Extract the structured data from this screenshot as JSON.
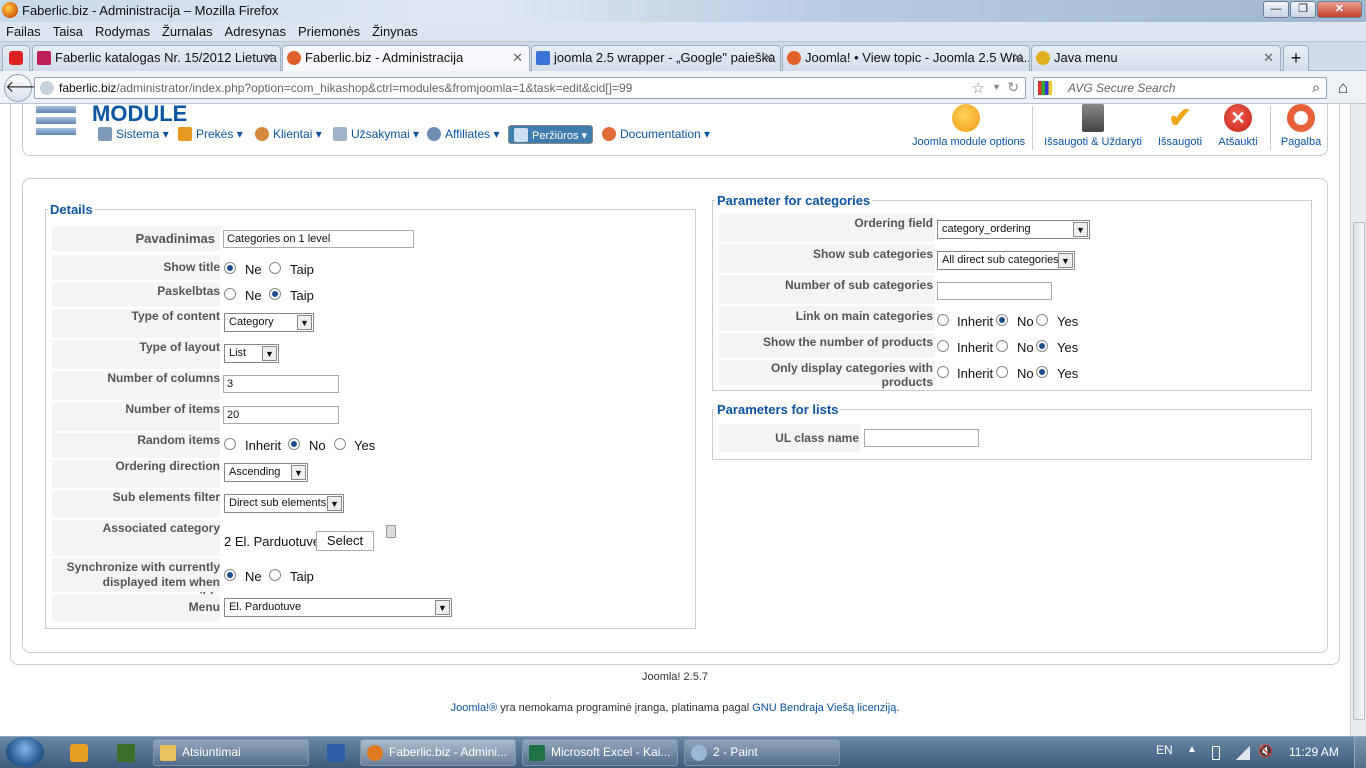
{
  "window": {
    "title": "Faberlic.biz - Administracija – Mozilla Firefox"
  },
  "menubar": [
    "Failas",
    "Taisa",
    "Rodymas",
    "Žurnalas",
    "Adresynas",
    "Priemonės",
    "Žinynas"
  ],
  "tabs": [
    {
      "label": "Faberlic katalogas Nr. 15/2012 Lietuva",
      "icon": "faberlic-icon",
      "color": "#c0205a"
    },
    {
      "label": "Faberlic.biz - Administracija",
      "icon": "joomla-icon",
      "color": "#e0622a"
    },
    {
      "label": "joomla 2.5 wrapper - „Google\" paieška",
      "icon": "google-icon",
      "color": "#3b73d6"
    },
    {
      "label": "Joomla! • View topic - Joomla 2.5 Wra...",
      "icon": "joomla-icon",
      "color": "#e0622a"
    },
    {
      "label": "Java menu",
      "icon": "star-icon",
      "color": "#e0b020"
    }
  ],
  "url": {
    "domain": "faberlic.biz",
    "path": "/administrator/index.php?option=com_hikashop&ctrl=modules&fromjoomla=1&task=edit&cid[]=99"
  },
  "search": {
    "placeholder": "AVG Secure Search"
  },
  "header": {
    "title": "MODULE",
    "nav": [
      "Sistema",
      "Prekės",
      "Klientai",
      "Užsakymai",
      "Affiliates",
      "Peržiūros",
      "Documentation"
    ],
    "toolbar": [
      "Joomla module options",
      "Išsaugoti & Uždaryti",
      "Išsaugoti",
      "Atšaukti",
      "Pagalba"
    ]
  },
  "details": {
    "legend": "Details",
    "name_label": "Pavadinimas",
    "name_value": "Categories on 1 level",
    "show_title_label": "Show title",
    "published_label": "Paskelbtas",
    "ne": "Ne",
    "taip": "Taip",
    "content_type_label": "Type of content",
    "content_type_value": "Category",
    "layout_label": "Type of layout",
    "layout_value": "List",
    "columns_label": "Number of columns",
    "columns_value": "3",
    "items_label": "Number of items",
    "items_value": "20",
    "random_label": "Random items",
    "inherit": "Inherit",
    "no": "No",
    "yes": "Yes",
    "ordering_dir_label": "Ordering direction",
    "ordering_dir_value": "Ascending",
    "sub_filter_label": "Sub elements filter",
    "sub_filter_value": "Direct sub elements",
    "assoc_label": "Associated category",
    "assoc_value": "2 El. Parduotuve",
    "select_button": "Select",
    "sync_label_1": "Synchronize with currently",
    "sync_label_2": "displayed item when possible",
    "menu_label": "Menu",
    "menu_value": "El. Parduotuve"
  },
  "categories": {
    "legend": "Parameter for categories",
    "ordering_field_label": "Ordering field",
    "ordering_field_value": "category_ordering",
    "show_sub_label": "Show sub categories",
    "show_sub_value": "All direct sub categories",
    "num_sub_label": "Number of sub categories",
    "num_sub_value": "",
    "link_main_label": "Link on main categories",
    "show_num_products_label": "Show the number of products",
    "only_display_label": "Only display categories with products"
  },
  "lists": {
    "legend": "Parameters for lists",
    "ul_class_label": "UL class name",
    "ul_class_value": ""
  },
  "footer": {
    "version": "Joomla! 2.5.7",
    "joomla_link": "Joomla!®",
    "text": " yra nemokama programinė įranga, platinama pagal ",
    "license_link": "GNU Bendraja Viešą licenziją",
    "period": "."
  },
  "taskbar": {
    "items": [
      "Atsiuntimai",
      "Faberlic.biz - Admini...",
      "Microsoft Excel - Kai...",
      "2 - Paint"
    ],
    "lang": "EN",
    "time": "11:29 AM"
  },
  "colors": {
    "accent": "#0b55a3",
    "selected_nav": "#3f7dae"
  }
}
